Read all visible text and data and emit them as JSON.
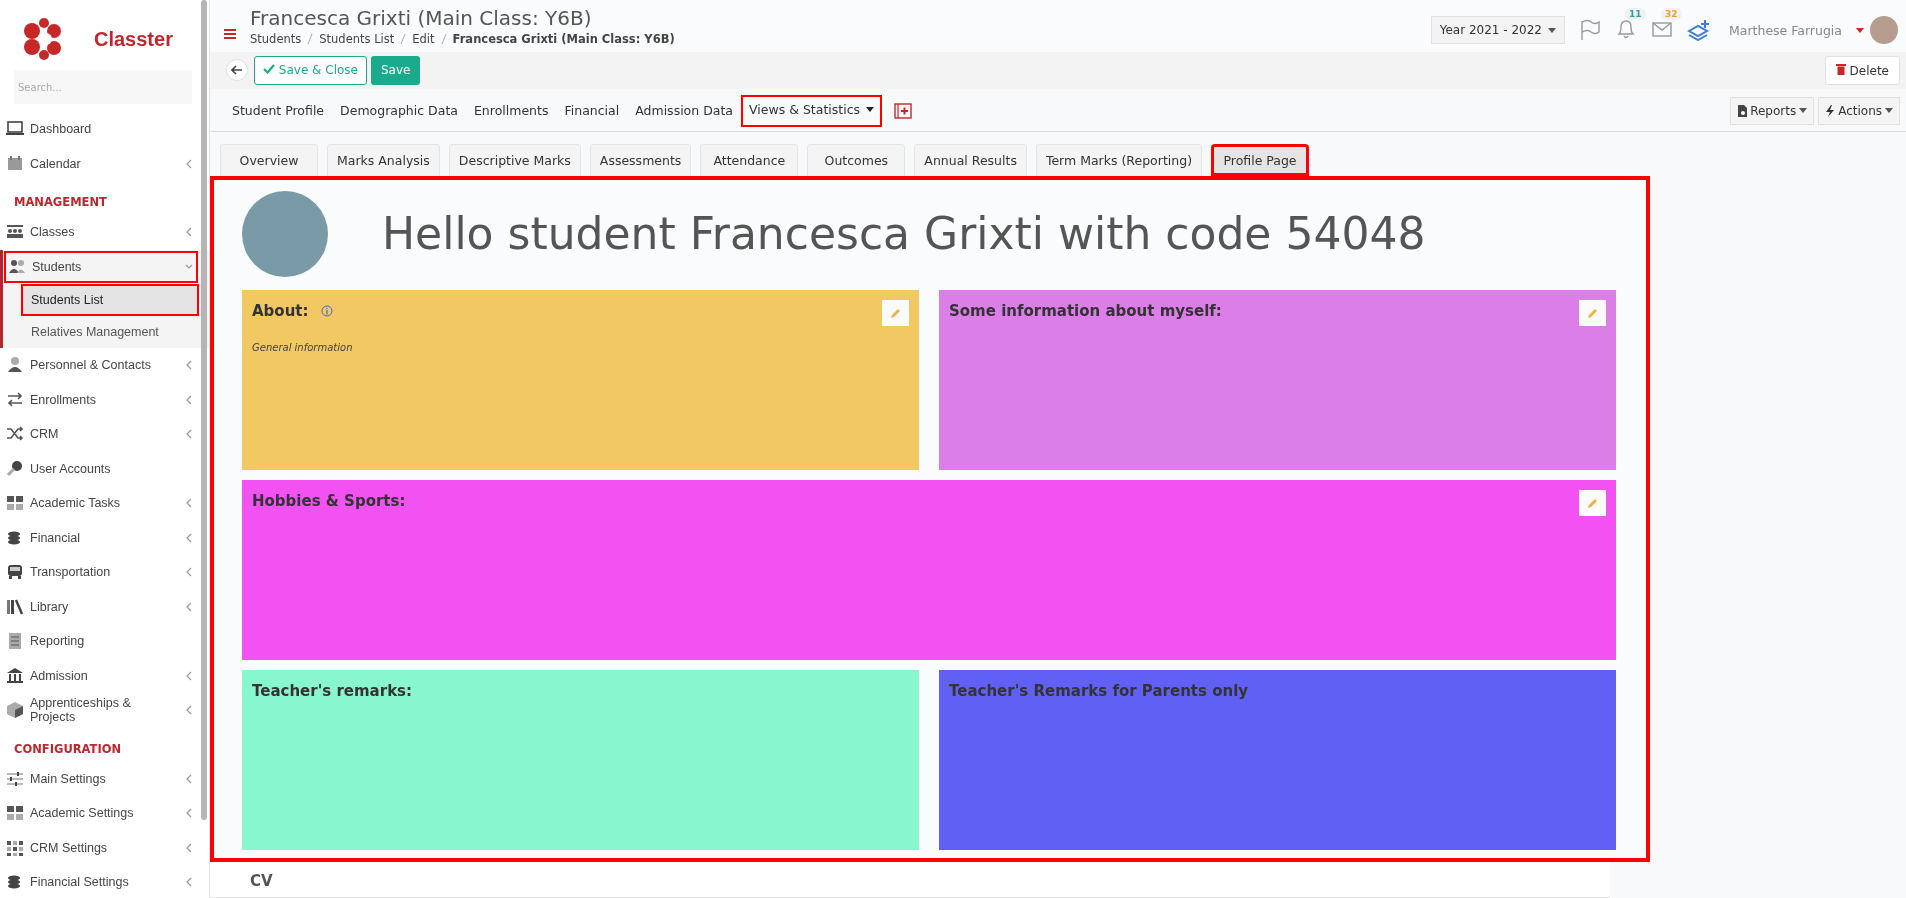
{
  "sidebar": {
    "brand": "Classter",
    "search": {
      "placeholder": "Search..."
    },
    "sections": [
      {
        "items": [
          {
            "label": "Dashboard",
            "expandable": false,
            "highlighted": false,
            "expanded": false
          },
          {
            "label": "Calendar",
            "expandable": true,
            "highlighted": false,
            "expanded": false
          }
        ]
      },
      {
        "heading": "MANAGEMENT",
        "items": [
          {
            "label": "Classes",
            "expandable": true,
            "highlighted": false,
            "expanded": false
          },
          {
            "label": "Students",
            "expandable": true,
            "highlighted": true,
            "expanded": true,
            "children": [
              {
                "label": "Students List",
                "selected": true,
                "highlighted": true
              },
              {
                "label": "Relatives Management",
                "selected": false,
                "highlighted": false
              }
            ]
          },
          {
            "label": "Personnel & Contacts",
            "expandable": true,
            "highlighted": false,
            "expanded": false
          },
          {
            "label": "Enrollments",
            "expandable": true,
            "highlighted": false,
            "expanded": false
          },
          {
            "label": "CRM",
            "expandable": true,
            "highlighted": false,
            "expanded": false
          },
          {
            "label": "User Accounts",
            "expandable": false,
            "highlighted": false,
            "expanded": false
          },
          {
            "label": "Academic Tasks",
            "expandable": true,
            "highlighted": false,
            "expanded": false
          },
          {
            "label": "Financial",
            "expandable": true,
            "highlighted": false,
            "expanded": false
          },
          {
            "label": "Transportation",
            "expandable": true,
            "highlighted": false,
            "expanded": false
          },
          {
            "label": "Library",
            "expandable": true,
            "highlighted": false,
            "expanded": false
          },
          {
            "label": "Reporting",
            "expandable": false,
            "highlighted": false,
            "expanded": false
          },
          {
            "label": "Admission",
            "expandable": true,
            "highlighted": false,
            "expanded": false
          },
          {
            "label": "Apprenticeships & Projects",
            "expandable": true,
            "highlighted": false,
            "expanded": false
          }
        ]
      },
      {
        "heading": "CONFIGURATION",
        "items": [
          {
            "label": "Main Settings",
            "expandable": true,
            "highlighted": false,
            "expanded": false
          },
          {
            "label": "Academic Settings",
            "expandable": true,
            "highlighted": false,
            "expanded": false
          },
          {
            "label": "CRM Settings",
            "expandable": true,
            "highlighted": false,
            "expanded": false
          },
          {
            "label": "Financial Settings",
            "expandable": true,
            "highlighted": false,
            "expanded": false
          }
        ]
      }
    ]
  },
  "header": {
    "title": "Francesca Grixti (Main Class: Y6B)",
    "breadcrumb": [
      "Students",
      "Students List",
      "Edit",
      "Francesca Grixti (Main Class: Y6B)"
    ],
    "year": "Year 2021 - 2022",
    "notifications": "11",
    "messages": "32",
    "user": "Marthese Farrugia"
  },
  "toolbar": {
    "save_close": "Save & Close",
    "save": "Save",
    "delete": "Delete"
  },
  "tabs": [
    {
      "label": "Student Profile",
      "selected": false,
      "dropdown": false,
      "highlighted": false
    },
    {
      "label": "Demographic Data",
      "selected": false,
      "dropdown": false,
      "highlighted": false
    },
    {
      "label": "Enrollments",
      "selected": false,
      "dropdown": false,
      "highlighted": false
    },
    {
      "label": "Financial",
      "selected": false,
      "dropdown": false,
      "highlighted": false
    },
    {
      "label": "Admission Data",
      "selected": false,
      "dropdown": false,
      "highlighted": false
    },
    {
      "label": "Views & Statistics",
      "selected": true,
      "dropdown": true,
      "highlighted": true
    }
  ],
  "tab_actions": [
    "Reports",
    "Actions"
  ],
  "subtabs": [
    {
      "label": "Overview",
      "selected": false,
      "highlighted": false
    },
    {
      "label": "Marks Analysis",
      "selected": false,
      "highlighted": false
    },
    {
      "label": "Descriptive Marks",
      "selected": false,
      "highlighted": false
    },
    {
      "label": "Assessments",
      "selected": false,
      "highlighted": false
    },
    {
      "label": "Attendance",
      "selected": false,
      "highlighted": false
    },
    {
      "label": "Outcomes",
      "selected": false,
      "highlighted": false
    },
    {
      "label": "Annual Results",
      "selected": false,
      "highlighted": false
    },
    {
      "label": "Term Marks (Reporting)",
      "selected": false,
      "highlighted": false
    },
    {
      "label": "Profile Page",
      "selected": true,
      "highlighted": true
    }
  ],
  "profile": {
    "highlighted": true,
    "greeting": "Hello student Francesca Grixti with code 54048",
    "rows": [
      [
        {
          "title": "About:",
          "info": true,
          "note": "General information",
          "editable": true,
          "color": "#f2c862"
        },
        {
          "title": "Some information about myself:",
          "info": false,
          "editable": true,
          "color": "#dc7ee8"
        }
      ],
      [
        {
          "title": "Hobbies & Sports:",
          "info": false,
          "editable": true,
          "color": "#f252f2"
        }
      ],
      [
        {
          "title": "Teacher's remarks:",
          "info": false,
          "editable": false,
          "color": "#88f7cf"
        },
        {
          "title": "Teacher's Remarks for Parents only",
          "info": false,
          "editable": false,
          "color": "#6060f4"
        }
      ]
    ]
  },
  "cv_heading": "CV"
}
